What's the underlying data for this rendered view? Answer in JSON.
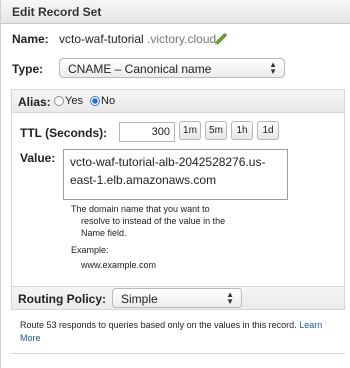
{
  "header": {
    "title": "Edit Record Set"
  },
  "name": {
    "label": "Name:",
    "value": "vcto-waf-tutorial",
    "suffix": ".victory.cloud.",
    "edit_icon": "pencil-icon"
  },
  "type": {
    "label": "Type:",
    "selected": "CNAME – Canonical name"
  },
  "alias": {
    "label": "Alias:",
    "yes_label": "Yes",
    "no_label": "No",
    "selected": "No"
  },
  "ttl": {
    "label": "TTL (Seconds):",
    "value": "300",
    "buttons": [
      "1m",
      "5m",
      "1h",
      "1d"
    ]
  },
  "value": {
    "label": "Value:",
    "text": "vcto-waf-tutorial-alb-2042528276.us-east-1.elb.amazonaws.com",
    "help_lines": [
      "The domain name that you want to",
      "resolve to instead of the value in the",
      "Name field."
    ],
    "example_label": "Example:",
    "example_value": "www.example.com"
  },
  "routing": {
    "label": "Routing Policy:",
    "selected": "Simple",
    "description": "Route 53 responds to queries based only on the values in this record.",
    "learn_more": "Learn More"
  },
  "colors": {
    "link": "#1a5aa6",
    "radio_selected": "#1f6fd6",
    "pencil": "#6aa526"
  }
}
